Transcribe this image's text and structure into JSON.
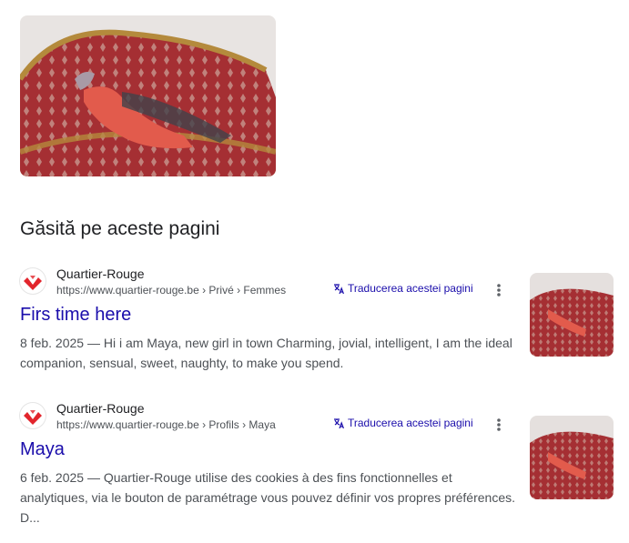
{
  "main_image": {
    "alt": ""
  },
  "section": {
    "title": "Găsită pe aceste pagini"
  },
  "results": [
    {
      "site_name": "Quartier-Rouge",
      "url": "https://www.quartier-rouge.be › Privé › Femmes",
      "translate_label": "Traducerea acestei pagini",
      "title": "Firs time here",
      "date": "8 feb. 2025",
      "snippet": "8 feb. 2025 — Hi i am Maya, new girl in town Charming, jovial, intelligent, I am the ideal companion, sensual, sweet, naughty, to make you spend."
    },
    {
      "site_name": "Quartier-Rouge",
      "url": "https://www.quartier-rouge.be › Profils › Maya",
      "translate_label": "Traducerea acestei pagini",
      "title": "Maya",
      "date": "6 feb. 2025",
      "snippet": "6 feb. 2025 — Quartier-Rouge utilise des cookies à des fins fonctionnelles et analytiques, via le bouton de paramétrage vous pouvez définir vos propres préférences. D..."
    }
  ],
  "colors": {
    "link": "#1a0dab",
    "text": "#202124",
    "muted": "#4d5156",
    "brand": "#e2252c"
  },
  "icons": [
    "quartier-rouge-favicon-icon",
    "translate-icon",
    "more-vert-icon"
  ]
}
